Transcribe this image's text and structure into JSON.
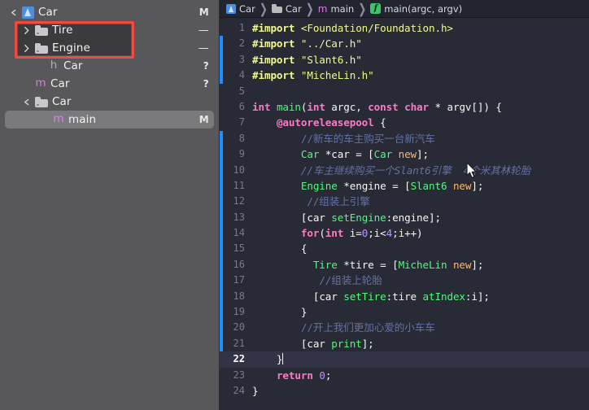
{
  "sidebar": {
    "name": "project-navigator",
    "rows": [
      {
        "indent": 0,
        "twisty": "down",
        "icon": "xcode-project-icon",
        "label": "Car",
        "status": "M",
        "selected": false
      },
      {
        "indent": 1,
        "twisty": "right",
        "icon": "folder-icon",
        "label": "Tire",
        "status": "—",
        "selected": false
      },
      {
        "indent": 1,
        "twisty": "right",
        "icon": "folder-icon",
        "label": "Engine",
        "status": "—",
        "selected": false
      },
      {
        "indent": 2,
        "twisty": "none",
        "icon": "header-file-icon",
        "label": "Car",
        "status": "?",
        "selected": false
      },
      {
        "indent": 1,
        "twisty": "none",
        "icon": "objc-file-icon",
        "label": "Car",
        "status": "?",
        "selected": false
      },
      {
        "indent": 1,
        "twisty": "down",
        "icon": "folder-icon",
        "label": "Car",
        "status": "",
        "selected": false
      },
      {
        "indent": 2,
        "twisty": "none",
        "icon": "objc-file-icon",
        "label": "main",
        "status": "M",
        "selected": true
      }
    ],
    "annotation": {
      "name": "red-highlight-box",
      "color": "#f4493f"
    }
  },
  "breadcrumb": {
    "items": [
      {
        "icon": "xcode-project-icon",
        "label": "Car"
      },
      {
        "icon": "folder-icon",
        "label": "Car"
      },
      {
        "icon": "objc-file-icon",
        "label": "main"
      },
      {
        "icon": "function-icon",
        "label": "main(argc, argv)"
      }
    ],
    "separator": "❯"
  },
  "editor": {
    "active_line": 22,
    "lines": [
      {
        "n": 1,
        "changed": false,
        "tokens": [
          {
            "c": "t-pp",
            "t": "#import"
          },
          {
            "c": "t-pln",
            "t": " "
          },
          {
            "c": "t-str",
            "t": "<Foundation/Foundation.h>"
          }
        ]
      },
      {
        "n": 2,
        "changed": true,
        "tokens": [
          {
            "c": "t-pp",
            "t": "#import"
          },
          {
            "c": "t-pln",
            "t": " "
          },
          {
            "c": "t-str",
            "t": "\"../Car.h\""
          }
        ]
      },
      {
        "n": 3,
        "changed": true,
        "tokens": [
          {
            "c": "t-pp",
            "t": "#import"
          },
          {
            "c": "t-pln",
            "t": " "
          },
          {
            "c": "t-str",
            "t": "\"Slant6.h\""
          }
        ]
      },
      {
        "n": 4,
        "changed": true,
        "tokens": [
          {
            "c": "t-pp",
            "t": "#import"
          },
          {
            "c": "t-pln",
            "t": " "
          },
          {
            "c": "t-str",
            "t": "\"MicheLin.h\""
          }
        ]
      },
      {
        "n": 5,
        "changed": false,
        "tokens": []
      },
      {
        "n": 6,
        "changed": false,
        "tokens": [
          {
            "c": "t-kw",
            "t": "int"
          },
          {
            "c": "t-pln",
            "t": " "
          },
          {
            "c": "t-fn",
            "t": "main"
          },
          {
            "c": "t-pln",
            "t": "("
          },
          {
            "c": "t-kw",
            "t": "int"
          },
          {
            "c": "t-pln",
            "t": " argc, "
          },
          {
            "c": "t-kw",
            "t": "const"
          },
          {
            "c": "t-pln",
            "t": " "
          },
          {
            "c": "t-kw",
            "t": "char"
          },
          {
            "c": "t-pln",
            "t": " * argv[]) {"
          }
        ]
      },
      {
        "n": 7,
        "changed": false,
        "tokens": [
          {
            "c": "t-pln",
            "t": "    "
          },
          {
            "c": "t-at",
            "t": "@autoreleasepool"
          },
          {
            "c": "t-pln",
            "t": " {"
          }
        ]
      },
      {
        "n": 8,
        "changed": true,
        "tokens": [
          {
            "c": "t-pln",
            "t": "        "
          },
          {
            "c": "t-cmt",
            "t": "//新车的车主购买一台新汽车"
          }
        ]
      },
      {
        "n": 9,
        "changed": true,
        "tokens": [
          {
            "c": "t-pln",
            "t": "        "
          },
          {
            "c": "t-cls",
            "t": "Car"
          },
          {
            "c": "t-pln",
            "t": " *car = ["
          },
          {
            "c": "t-cls",
            "t": "Car"
          },
          {
            "c": "t-pln",
            "t": " "
          },
          {
            "c": "t-orng",
            "t": "new"
          },
          {
            "c": "t-pln",
            "t": "];"
          }
        ]
      },
      {
        "n": 10,
        "changed": true,
        "tokens": [
          {
            "c": "t-pln",
            "t": "        "
          },
          {
            "c": "t-cmt-i",
            "t": "//车主继续购买一个Slant6引擎  4个米其林轮胎"
          }
        ]
      },
      {
        "n": 11,
        "changed": true,
        "tokens": [
          {
            "c": "t-pln",
            "t": "        "
          },
          {
            "c": "t-cls",
            "t": "Engine"
          },
          {
            "c": "t-pln",
            "t": " *engine = ["
          },
          {
            "c": "t-cls",
            "t": "Slant6"
          },
          {
            "c": "t-pln",
            "t": " "
          },
          {
            "c": "t-orng",
            "t": "new"
          },
          {
            "c": "t-pln",
            "t": "];"
          }
        ]
      },
      {
        "n": 12,
        "changed": true,
        "tokens": [
          {
            "c": "t-pln",
            "t": "         "
          },
          {
            "c": "t-cmt",
            "t": "//组装上引擎"
          }
        ]
      },
      {
        "n": 13,
        "changed": true,
        "tokens": [
          {
            "c": "t-pln",
            "t": "        ["
          },
          {
            "c": "t-pln",
            "t": "car"
          },
          {
            "c": "t-pln",
            "t": " "
          },
          {
            "c": "t-fn",
            "t": "setEngine"
          },
          {
            "c": "t-pln",
            "t": ":engine];"
          }
        ]
      },
      {
        "n": 14,
        "changed": true,
        "tokens": [
          {
            "c": "t-pln",
            "t": "        "
          },
          {
            "c": "t-kw",
            "t": "for"
          },
          {
            "c": "t-pln",
            "t": "("
          },
          {
            "c": "t-kw",
            "t": "int"
          },
          {
            "c": "t-pln",
            "t": " i="
          },
          {
            "c": "t-num",
            "t": "0"
          },
          {
            "c": "t-pln",
            "t": ";i<"
          },
          {
            "c": "t-num",
            "t": "4"
          },
          {
            "c": "t-pln",
            "t": ";i++)"
          }
        ]
      },
      {
        "n": 15,
        "changed": true,
        "tokens": [
          {
            "c": "t-pln",
            "t": "        {"
          }
        ]
      },
      {
        "n": 16,
        "changed": true,
        "tokens": [
          {
            "c": "t-pln",
            "t": "          "
          },
          {
            "c": "t-cls",
            "t": "Tire"
          },
          {
            "c": "t-pln",
            "t": " *tire = ["
          },
          {
            "c": "t-cls",
            "t": "MicheLin"
          },
          {
            "c": "t-pln",
            "t": " "
          },
          {
            "c": "t-orng",
            "t": "new"
          },
          {
            "c": "t-pln",
            "t": "];"
          }
        ]
      },
      {
        "n": 17,
        "changed": true,
        "tokens": [
          {
            "c": "t-pln",
            "t": "           "
          },
          {
            "c": "t-cmt",
            "t": "//组装上轮胎"
          }
        ]
      },
      {
        "n": 18,
        "changed": true,
        "tokens": [
          {
            "c": "t-pln",
            "t": "          ["
          },
          {
            "c": "t-pln",
            "t": "car"
          },
          {
            "c": "t-pln",
            "t": " "
          },
          {
            "c": "t-fn",
            "t": "setTire"
          },
          {
            "c": "t-pln",
            "t": ":tire "
          },
          {
            "c": "t-fn",
            "t": "atIndex"
          },
          {
            "c": "t-pln",
            "t": ":i];"
          }
        ]
      },
      {
        "n": 19,
        "changed": true,
        "tokens": [
          {
            "c": "t-pln",
            "t": "        }"
          }
        ]
      },
      {
        "n": 20,
        "changed": true,
        "tokens": [
          {
            "c": "t-pln",
            "t": "        "
          },
          {
            "c": "t-cmt",
            "t": "//开上我们更加心爱的小车车"
          }
        ]
      },
      {
        "n": 21,
        "changed": true,
        "tokens": [
          {
            "c": "t-pln",
            "t": "        ["
          },
          {
            "c": "t-pln",
            "t": "car"
          },
          {
            "c": "t-pln",
            "t": " "
          },
          {
            "c": "t-fn",
            "t": "print"
          },
          {
            "c": "t-pln",
            "t": "];"
          }
        ]
      },
      {
        "n": 22,
        "changed": false,
        "caret": true,
        "tokens": [
          {
            "c": "t-pln",
            "t": "    }"
          }
        ]
      },
      {
        "n": 23,
        "changed": false,
        "tokens": [
          {
            "c": "t-pln",
            "t": "    "
          },
          {
            "c": "t-kw",
            "t": "return"
          },
          {
            "c": "t-pln",
            "t": " "
          },
          {
            "c": "t-num",
            "t": "0"
          },
          {
            "c": "t-pln",
            "t": ";"
          }
        ]
      },
      {
        "n": 24,
        "changed": false,
        "tokens": [
          {
            "c": "t-pln",
            "t": "}"
          }
        ]
      }
    ]
  },
  "colors": {
    "editor_bg": "#282a36",
    "sidebar_bg": "#58585a",
    "active_line_bg": "#323445",
    "change_bar": "#1f8fff",
    "annotation_red": "#f4493f",
    "keyword": "#ff79c6",
    "function": "#50fa7b",
    "string": "#f1fa8c",
    "comment": "#6272a4",
    "number": "#bd93f9",
    "builtin": "#ffb86c"
  }
}
